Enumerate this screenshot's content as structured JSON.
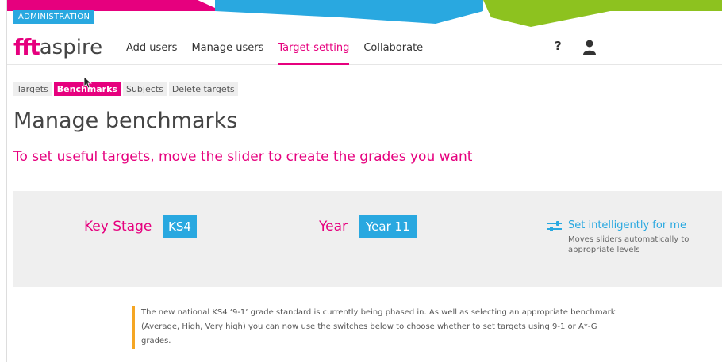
{
  "header": {
    "admin_badge": "ADMINISTRATION",
    "logo_fft": "fft",
    "logo_aspire": "aspire",
    "help_label": "?"
  },
  "nav": {
    "items": [
      {
        "label": "Add users"
      },
      {
        "label": "Manage users"
      },
      {
        "label": "Target-setting"
      },
      {
        "label": "Collaborate"
      }
    ],
    "active_index": 2
  },
  "subtabs": {
    "items": [
      {
        "label": "Targets"
      },
      {
        "label": "Benchmarks"
      },
      {
        "label": "Subjects"
      },
      {
        "label": "Delete targets"
      }
    ],
    "active_index": 1
  },
  "main": {
    "title": "Manage benchmarks",
    "subtitle": "To set useful targets, move the slider to create the grades you want"
  },
  "panel": {
    "key_stage_label": "Key Stage",
    "key_stage_value": "KS4",
    "year_label": "Year",
    "year_value": "Year 11",
    "set_intel_label": "Set intelligently for me",
    "set_intel_desc": "Moves sliders automatically to appropriate levels"
  },
  "notice": {
    "text": "The new national KS4 ‘9-1’ grade standard is currently being phased in. As well as selecting an appropriate benchmark (Average, High, Very high) you can now use the switches below to choose whether to set targets using 9-1 or A*-G grades."
  },
  "colors": {
    "brand_pink": "#e6007e",
    "brand_blue": "#29a8e0",
    "brand_green": "#8dc21f",
    "notice_accent": "#f5a623"
  },
  "icons": {
    "help": "question-mark-icon",
    "user": "user-icon",
    "sliders": "sliders-icon",
    "cursor": "mouse-pointer-icon"
  }
}
